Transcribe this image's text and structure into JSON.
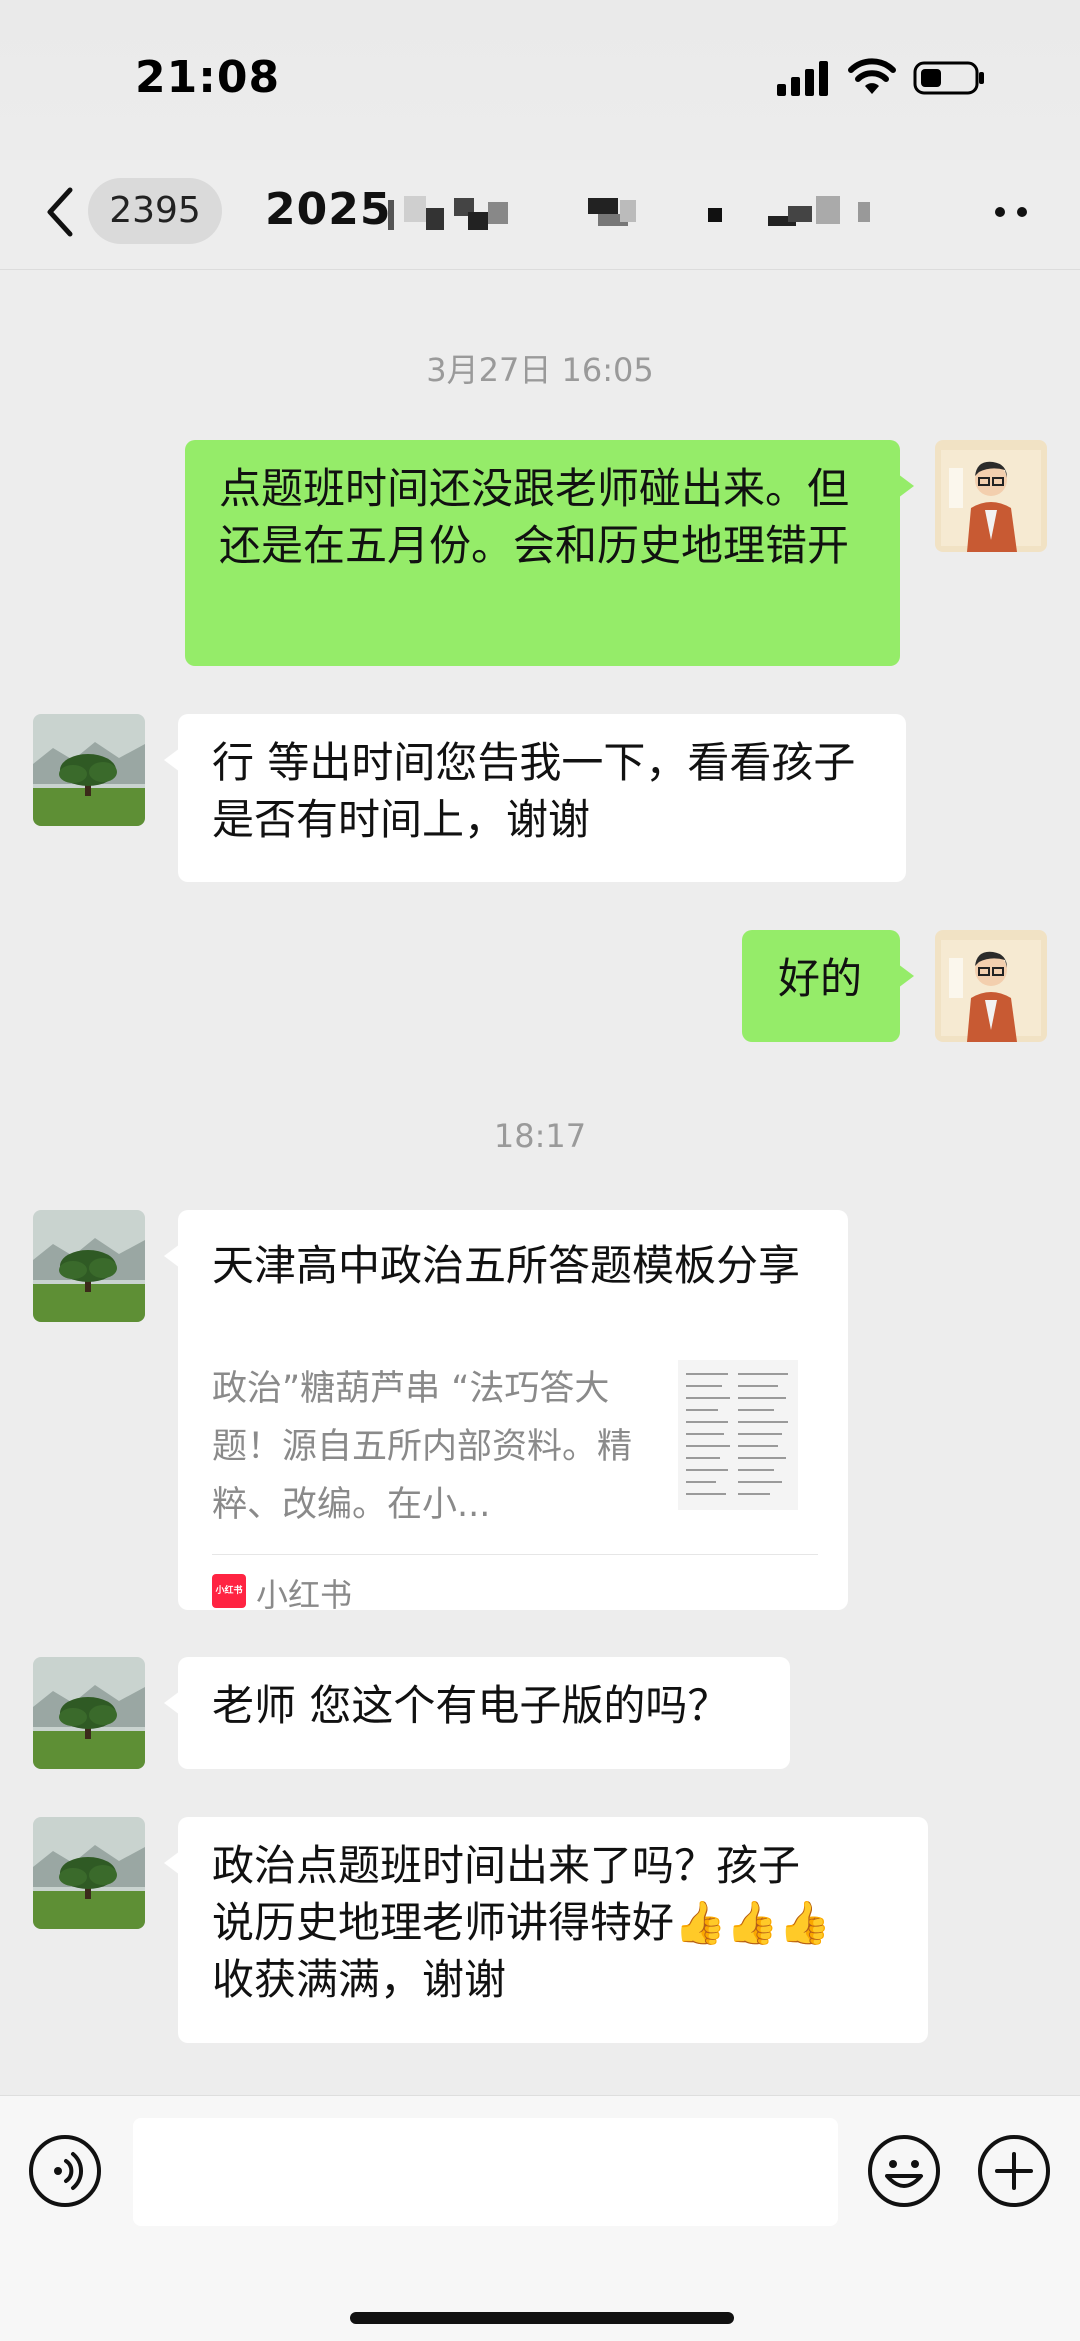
{
  "status_bar": {
    "time": "21:08"
  },
  "nav": {
    "unread_count": "2395",
    "title_visible": "2025"
  },
  "messages": [
    {
      "type": "time",
      "text": "3月27日 16:05"
    },
    {
      "type": "me",
      "text": "点题班时间还没跟老师碰出来。但还是在五月份。会和历史地理错开"
    },
    {
      "type": "them",
      "text": "行 等出时间您告我一下，看看孩子是否有时间上，谢谢"
    },
    {
      "type": "me",
      "text": "好的"
    },
    {
      "type": "time",
      "text": "18:17"
    },
    {
      "type": "them_card",
      "title": "天津高中政治五所答题模板分享",
      "description": "政治”糖葫芦串 “法巧答大题！源自五所内部资料。精粹、改编。在小...",
      "source": "小红书",
      "source_badge": "小红书"
    },
    {
      "type": "them",
      "text": "老师 您这个有电子版的吗？"
    },
    {
      "type": "them",
      "text_line1": "政治点题班时间出来了吗？孩子",
      "text_line2": "说历史地理老师讲得特好",
      "emoji": "👍👍👍",
      "text_line3": "收获满满，谢谢"
    }
  ],
  "input": {
    "value": ""
  },
  "colors": {
    "my_bubble": "#95ec69",
    "their_bubble": "#ffffff",
    "background": "#ededed",
    "xiaohongshu": "#ff2442"
  },
  "icons": [
    "signal-icon",
    "wifi-icon",
    "battery-icon",
    "back-icon",
    "more-icon",
    "voice-icon",
    "emoji-icon",
    "plus-icon"
  ]
}
